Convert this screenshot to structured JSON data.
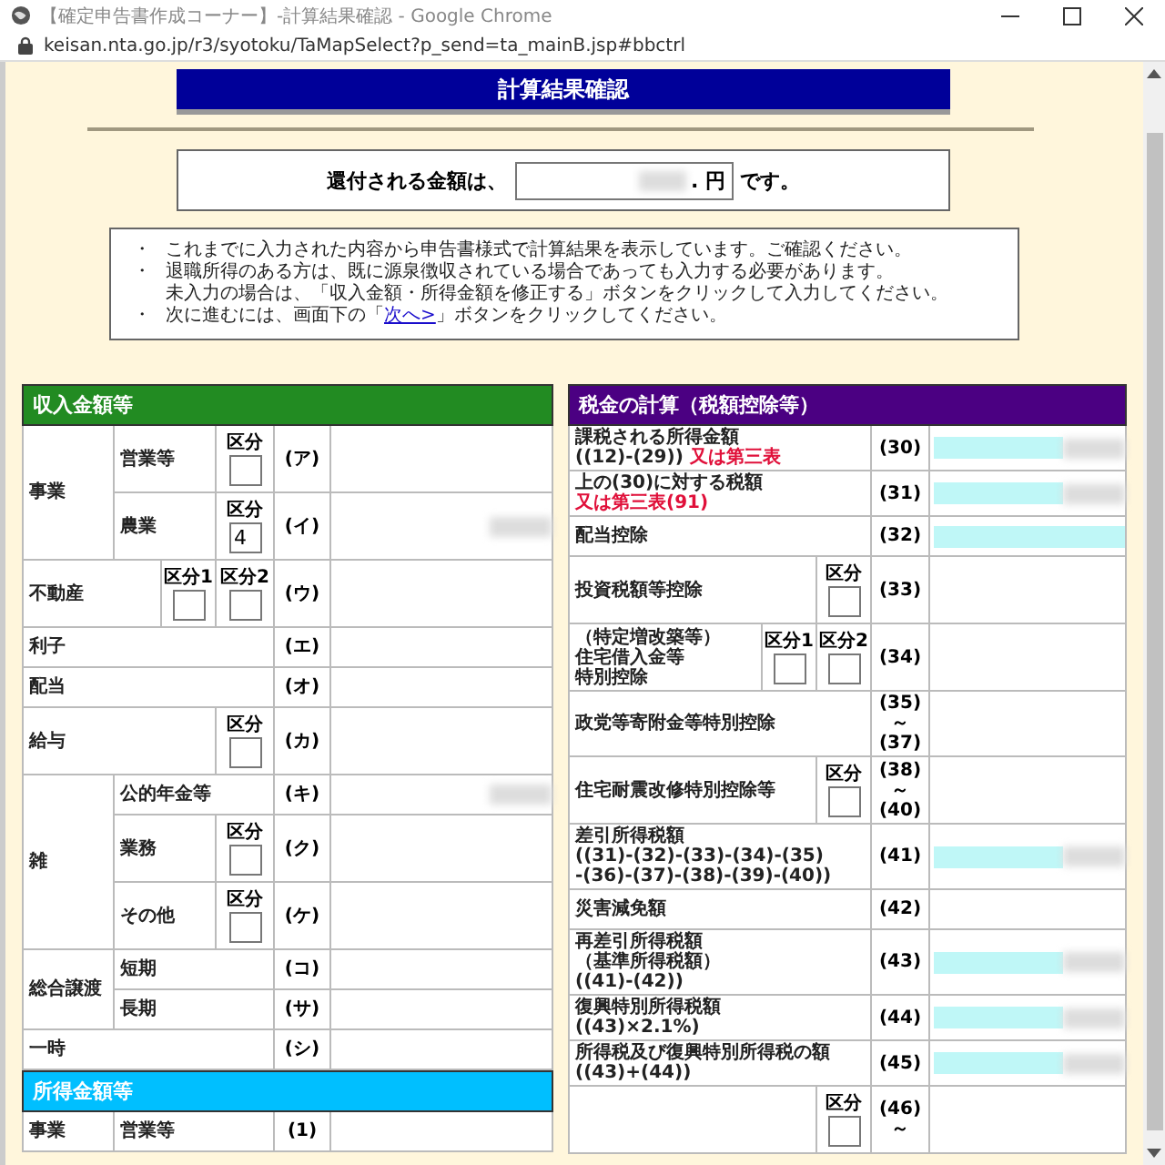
{
  "window": {
    "title": "【確定申告書作成コーナー】-計算結果確認 - Google Chrome",
    "url": "keisan.nta.go.jp/r3/syotoku/TaMapSelect?p_send=ta_mainB.jsp#bbctrl"
  },
  "heading": "計算結果確認",
  "refund": {
    "before": "還付される金額は、",
    "unit": ". 円",
    "after": "です。",
    "redacted": true
  },
  "notes": [
    {
      "bullet": "・",
      "lines": [
        "これまでに入力された内容から申告書様式で計算結果を表示しています。ご確認ください。"
      ]
    },
    {
      "bullet": "・",
      "lines": [
        "退職所得のある方は、既に源泉徴収されている場合であっても入力する必要があります。",
        "未入力の場合は、「収入金額・所得金額を修正する」ボタンをクリックして入力してください。"
      ]
    },
    {
      "bullet": "・",
      "lines": [
        "次に進むには、画面下の「"
      ],
      "link": "次へ>",
      "after": "」ボタンをクリックしてください。"
    }
  ],
  "left_sections": [
    {
      "title": "収入金額等",
      "color": "#228b22",
      "rows": [
        {
          "group": "事業",
          "items": [
            {
              "label": "営業等",
              "kubun": [
                {
                  "label": "区分"
                }
              ],
              "code": "(ア)",
              "computed": false,
              "redacted": false
            },
            {
              "label": "農業",
              "kubun": [
                {
                  "label": "区分",
                  "value": "4"
                }
              ],
              "code": "(イ)",
              "computed": false,
              "redacted": true
            }
          ]
        },
        {
          "label": "不動産",
          "kubun": [
            {
              "label": "区分1"
            },
            {
              "label": "区分2"
            }
          ],
          "code": "(ウ)",
          "computed": false,
          "redacted": false
        },
        {
          "label": "利子",
          "code": "(エ)",
          "computed": false,
          "redacted": false
        },
        {
          "label": "配当",
          "code": "(オ)",
          "computed": false,
          "redacted": false
        },
        {
          "label": "給与",
          "kubun": [
            {
              "label": "区分"
            }
          ],
          "code": "(カ)",
          "computed": false,
          "redacted": false
        },
        {
          "group": "雑",
          "items": [
            {
              "label": "公的年金等",
              "code": "(キ)",
              "computed": false,
              "redacted": true
            },
            {
              "label": "業務",
              "kubun": [
                {
                  "label": "区分"
                }
              ],
              "code": "(ク)",
              "computed": false,
              "redacted": false
            },
            {
              "label": "その他",
              "kubun": [
                {
                  "label": "区分"
                }
              ],
              "code": "(ケ)",
              "computed": false,
              "redacted": false
            }
          ]
        },
        {
          "group": "総合譲渡",
          "items": [
            {
              "label": "短期",
              "code": "(コ)",
              "computed": false,
              "redacted": false
            },
            {
              "label": "長期",
              "code": "(サ)",
              "computed": false,
              "redacted": false
            }
          ]
        },
        {
          "label": "一時",
          "code": "(シ)",
          "computed": false,
          "redacted": false
        }
      ]
    },
    {
      "title": "所得金額等",
      "color": "#00bfff",
      "rows": [
        {
          "group": "事業",
          "items": [
            {
              "label": "営業等",
              "code": "(1)",
              "computed": false,
              "redacted": false
            }
          ]
        }
      ]
    }
  ],
  "right_sections": [
    {
      "title": "税金の計算（税額控除等）",
      "color": "#4b0082",
      "rows": [
        {
          "lines": [
            [
              {
                "text": "課税される所得金額",
                "kind": "plain"
              }
            ],
            [
              {
                "text": "((12)-(29)) ",
                "kind": "plain"
              },
              {
                "text": "又は第三表",
                "kind": "note"
              }
            ]
          ],
          "code": "(30)",
          "computed": true,
          "redacted": true
        },
        {
          "lines": [
            [
              {
                "text": "上の(30)に対する税額",
                "kind": "plain"
              }
            ],
            [
              {
                "text": "又は第三表(91)",
                "kind": "note"
              }
            ]
          ],
          "code": "(31)",
          "computed": true,
          "redacted": true
        },
        {
          "lines": [
            [
              {
                "text": "配当控除",
                "kind": "plain"
              }
            ]
          ],
          "code": "(32)",
          "computed": true,
          "redacted": false
        },
        {
          "lines": [
            [
              {
                "text": "投資税額等控除",
                "kind": "plain"
              }
            ]
          ],
          "kubun": [
            {
              "label": "区分"
            }
          ],
          "code": "(33)",
          "computed": false,
          "redacted": false
        },
        {
          "lines": [
            [
              {
                "text": "（特定増改築等）",
                "kind": "plain"
              }
            ],
            [
              {
                "text": "住宅借入金等",
                "kind": "plain"
              }
            ],
            [
              {
                "text": "特別控除",
                "kind": "plain"
              }
            ]
          ],
          "kubun": [
            {
              "label": "区分1"
            },
            {
              "label": "区分2"
            }
          ],
          "code": "(34)",
          "computed": false,
          "redacted": false
        },
        {
          "lines": [
            [
              {
                "text": "政党等寄附金等特別控除",
                "kind": "plain"
              }
            ]
          ],
          "code": "(35)～\n(37)",
          "computed": false,
          "redacted": false
        },
        {
          "lines": [
            [
              {
                "text": "住宅耐震改修特別控除等",
                "kind": "plain"
              }
            ]
          ],
          "kubun": [
            {
              "label": "区分"
            }
          ],
          "code": "(38)～\n(40)",
          "computed": false,
          "redacted": false
        },
        {
          "lines": [
            [
              {
                "text": "差引所得税額",
                "kind": "plain"
              }
            ],
            [
              {
                "text": "((31)-(32)-(33)-(34)-(35)",
                "kind": "plain"
              }
            ],
            [
              {
                "text": "-(36)-(37)-(38)-(39)-(40))",
                "kind": "plain"
              }
            ]
          ],
          "code": "(41)",
          "computed": true,
          "redacted": true
        },
        {
          "lines": [
            [
              {
                "text": "災害減免額",
                "kind": "plain"
              }
            ]
          ],
          "code": "(42)",
          "computed": false,
          "redacted": false
        },
        {
          "lines": [
            [
              {
                "text": "再差引所得税額",
                "kind": "plain"
              }
            ],
            [
              {
                "text": "（基準所得税額）",
                "kind": "plain"
              }
            ],
            [
              {
                "text": "((41)-(42))",
                "kind": "plain"
              }
            ]
          ],
          "code": "(43)",
          "computed": true,
          "redacted": true
        },
        {
          "lines": [
            [
              {
                "text": "復興特別所得税額",
                "kind": "plain"
              }
            ],
            [
              {
                "text": "((43)×2.1%)",
                "kind": "plain"
              }
            ]
          ],
          "code": "(44)",
          "computed": true,
          "redacted": true
        },
        {
          "lines": [
            [
              {
                "text": "所得税及び復興特別所得税の額",
                "kind": "plain"
              }
            ],
            [
              {
                "text": "((43)+(44))",
                "kind": "plain"
              }
            ]
          ],
          "code": "(45)",
          "computed": true,
          "redacted": true
        },
        {
          "kubun": [
            {
              "label": "区分"
            }
          ],
          "code": "(46)～",
          "computed": false,
          "redacted": false
        }
      ]
    }
  ]
}
